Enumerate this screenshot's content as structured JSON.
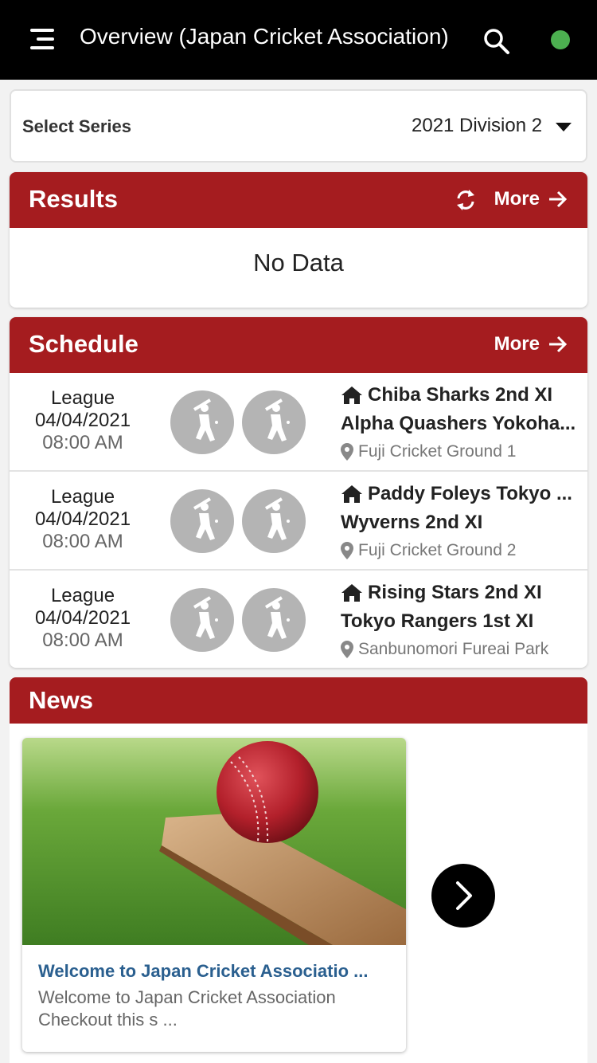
{
  "header": {
    "title": "Overview (Japan Cricket Association)",
    "status_color": "#4cb050"
  },
  "series": {
    "label": "Select Series",
    "selected": "2021 Division 2"
  },
  "results": {
    "title": "Results",
    "more_label": "More",
    "empty_text": "No Data"
  },
  "schedule": {
    "title": "Schedule",
    "more_label": "More",
    "matches": [
      {
        "type": "League",
        "date": "04/04/2021",
        "time": "08:00 AM",
        "home": "Chiba Sharks 2nd XI",
        "away": "Alpha Quashers Yokoha...",
        "ground": "Fuji Cricket Ground 1"
      },
      {
        "type": "League",
        "date": "04/04/2021",
        "time": "08:00 AM",
        "home": "Paddy Foleys Tokyo ...",
        "away": "Wyverns 2nd XI",
        "ground": "Fuji Cricket Ground 2"
      },
      {
        "type": "League",
        "date": "04/04/2021",
        "time": "08:00 AM",
        "home": "Rising Stars 2nd XI",
        "away": "Tokyo Rangers 1st XI",
        "ground": "Sanbunomori Fureai Park"
      }
    ]
  },
  "news": {
    "title": "News",
    "items": [
      {
        "title": "Welcome to Japan Cricket Associatio ...",
        "desc": "Welcome to Japan Cricket Association Checkout this s ..."
      }
    ]
  },
  "colors": {
    "accent": "#a51c1f",
    "link": "#2a5f8f"
  }
}
